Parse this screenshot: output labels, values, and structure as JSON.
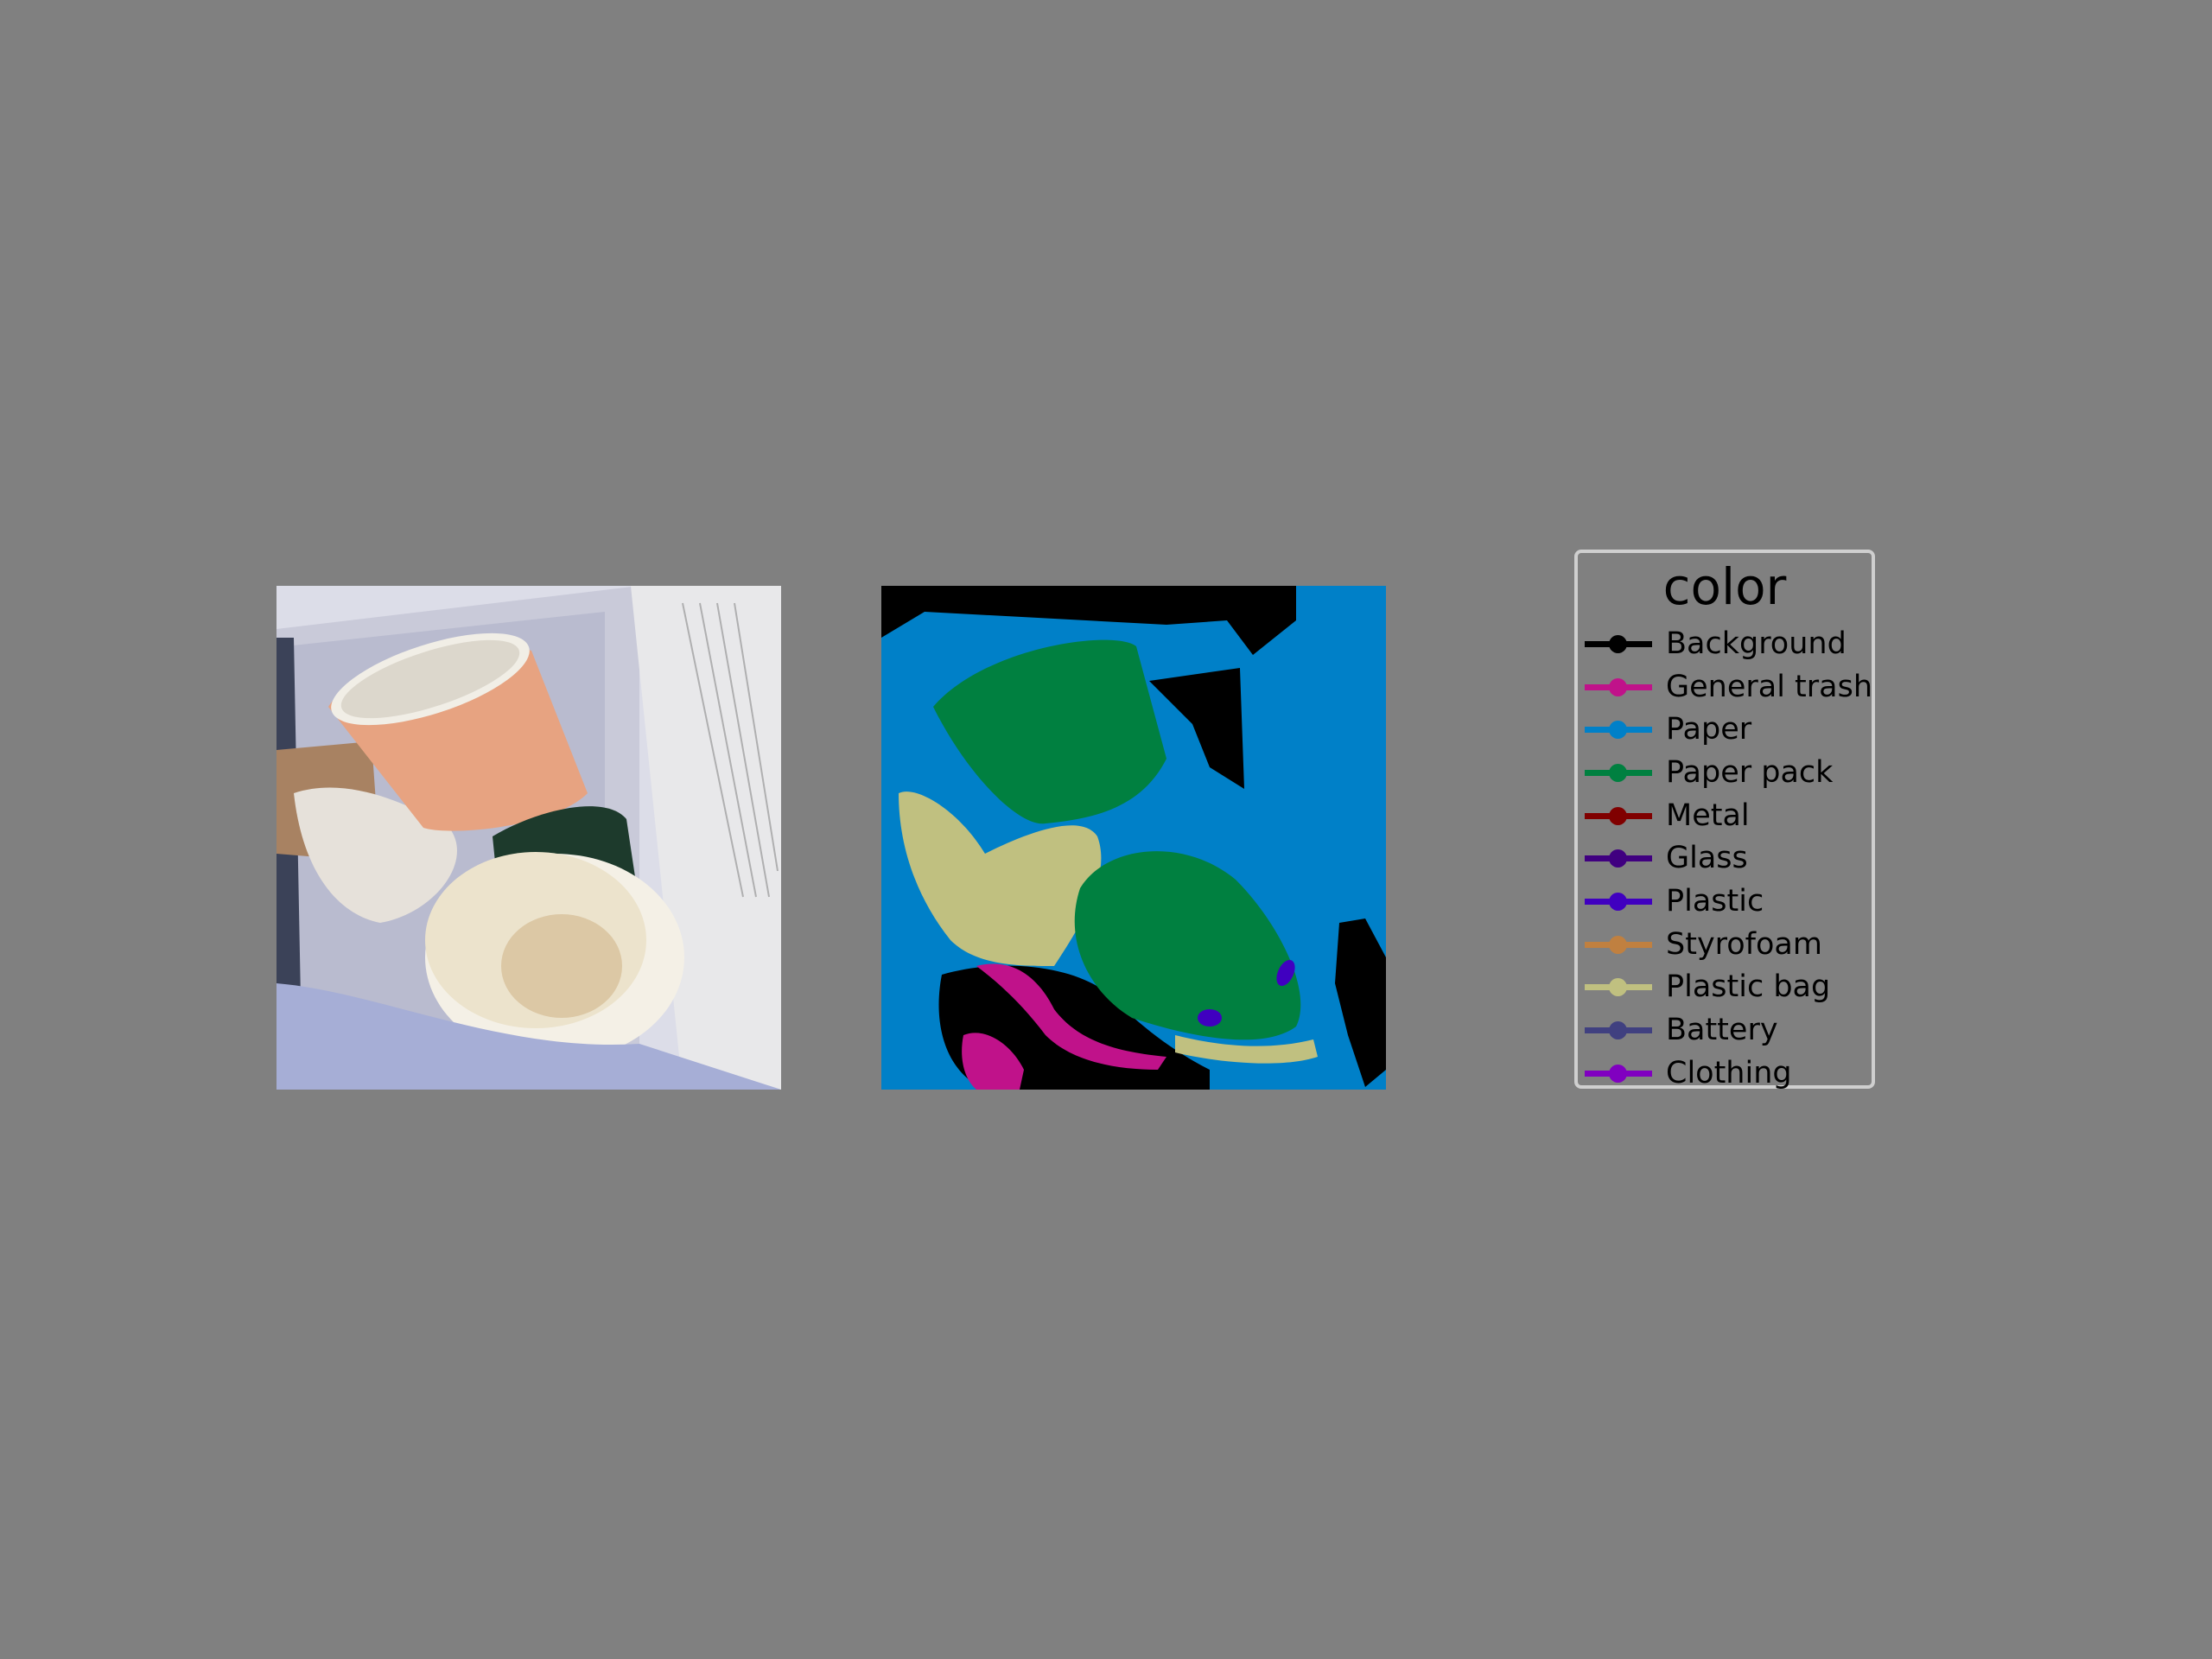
{
  "legend": {
    "title": "color",
    "items": [
      {
        "label": "Background",
        "color": "#000000"
      },
      {
        "label": "General trash",
        "color": "#c0128a"
      },
      {
        "label": "Paper",
        "color": "#0080c8"
      },
      {
        "label": "Paper pack",
        "color": "#008040"
      },
      {
        "label": "Metal",
        "color": "#800000"
      },
      {
        "label": "Glass",
        "color": "#400080"
      },
      {
        "label": "Plastic",
        "color": "#4000c0"
      },
      {
        "label": "Styrofoam",
        "color": "#c08040"
      },
      {
        "label": "Plastic bag",
        "color": "#c0c080"
      },
      {
        "label": "Battery",
        "color": "#404080"
      },
      {
        "label": "Clothing",
        "color": "#8000c0"
      }
    ]
  }
}
